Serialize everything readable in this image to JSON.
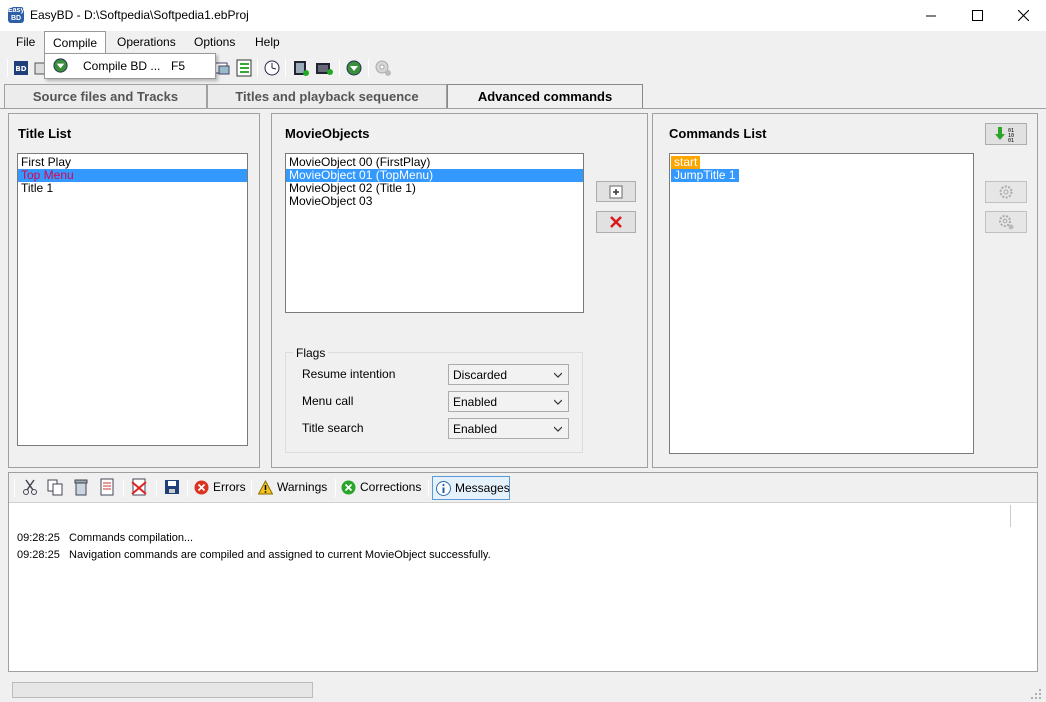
{
  "window": {
    "app_icon_text": "Easy BD",
    "title": "EasyBD - D:\\Softpedia\\Softpedia1.ebProj",
    "minimize": "—",
    "maximize": "☐",
    "close": "✕"
  },
  "menu": {
    "items": [
      "File",
      "Compile",
      "Operations",
      "Options",
      "Help"
    ],
    "open": "Compile",
    "dropdown": [
      {
        "label": "Compile BD ...",
        "shortcut": "F5",
        "icon": "compile-icon"
      }
    ]
  },
  "toolbar": {
    "icons": [
      "bd-icon",
      "open-icon",
      "compile-icon",
      "export-icon",
      "list-icon",
      "clock-icon",
      "film-add-icon",
      "film-export-icon",
      "compile-icon",
      "disc-icon"
    ]
  },
  "tabs": [
    {
      "label": "Source files and Tracks",
      "active": false
    },
    {
      "label": "Titles and playback sequence",
      "active": false
    },
    {
      "label": "Advanced commands",
      "active": true
    }
  ],
  "title_list": {
    "heading": "Title List",
    "items": [
      {
        "label": "First Play",
        "state": "normal"
      },
      {
        "label": "Top Menu",
        "state": "selected"
      },
      {
        "label": "Title 1",
        "state": "normal"
      }
    ]
  },
  "movie_objects": {
    "heading": "MovieObjects",
    "items": [
      {
        "label": "MovieObject  00  (FirstPlay)",
        "state": "normal"
      },
      {
        "label": "MovieObject  01  (TopMenu)",
        "state": "selected"
      },
      {
        "label": "MovieObject  02  (Title 1)",
        "state": "normal"
      },
      {
        "label": "MovieObject  03",
        "state": "normal"
      }
    ]
  },
  "flags": {
    "legend": "Flags",
    "rows": [
      {
        "label": "Resume intention",
        "value": "Discarded"
      },
      {
        "label": "Menu call",
        "value": "Enabled"
      },
      {
        "label": "Title search",
        "value": "Enabled"
      }
    ]
  },
  "commands": {
    "heading": "Commands List",
    "items": [
      {
        "label": "start",
        "state": "highlight"
      },
      {
        "label": "JumpTitle 1",
        "state": "selected"
      }
    ]
  },
  "messages": {
    "tabs": [
      "Errors",
      "Warnings",
      "Corrections",
      "Messages"
    ],
    "active_tab": "Messages",
    "log": [
      {
        "time": "09:28:25",
        "text": "Commands compilation..."
      },
      {
        "time": "09:28:25",
        "text": "Navigation commands are compiled and assigned to current MovieObject successfully."
      }
    ]
  },
  "colors": {
    "selection": "#3399ff",
    "highlight_orange": "#ffa500",
    "red_text": "#e0004d",
    "delete_red": "#d9191f",
    "green_arrow": "#2aa52a"
  }
}
